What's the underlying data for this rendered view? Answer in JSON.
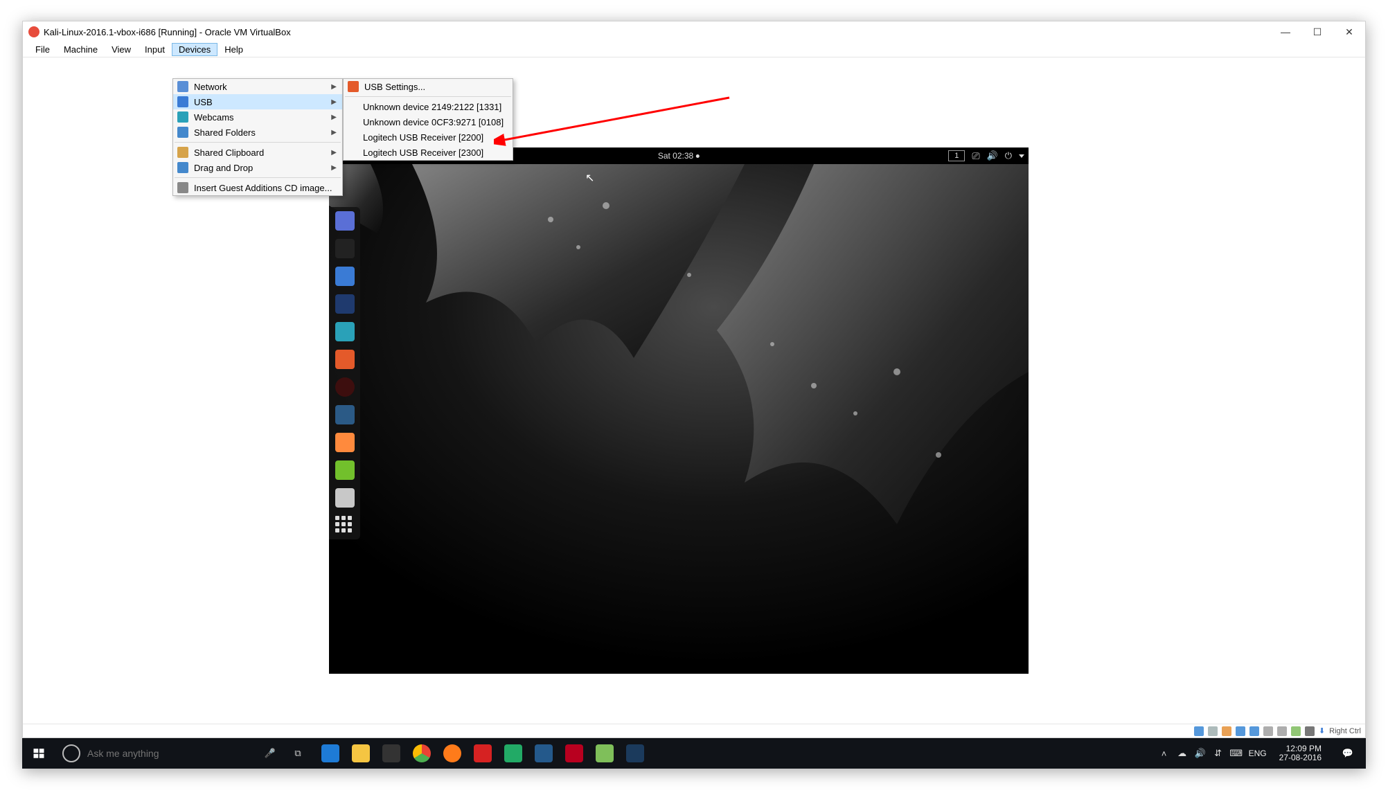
{
  "vbox": {
    "title": "Kali-Linux-2016.1-vbox-i686 [Running] - Oracle VM VirtualBox",
    "menubar": [
      "File",
      "Machine",
      "View",
      "Input",
      "Devices",
      "Help"
    ],
    "active_menu": "Devices",
    "status_label": "Right Ctrl"
  },
  "devices_menu": {
    "items": [
      {
        "icon": "net",
        "label": "Network",
        "submenu": true
      },
      {
        "icon": "usb",
        "label": "USB",
        "submenu": true,
        "highlight": true
      },
      {
        "icon": "cam",
        "label": "Webcams",
        "submenu": true
      },
      {
        "icon": "folder",
        "label": "Shared Folders",
        "submenu": true
      },
      {
        "sep": true
      },
      {
        "icon": "clip",
        "label": "Shared Clipboard",
        "submenu": true
      },
      {
        "icon": "drag",
        "label": "Drag and Drop",
        "submenu": true
      },
      {
        "sep": true
      },
      {
        "icon": "cd",
        "label": "Insert Guest Additions CD image..."
      }
    ]
  },
  "usb_menu": {
    "settings_label": "USB Settings...",
    "devices": [
      "Unknown device 2149:2122 [1331]",
      "Unknown device 0CF3:9271 [0108]",
      "Logitech USB Receiver [2200]",
      "Logitech USB Receiver [2300]"
    ]
  },
  "guest": {
    "clock": "Sat 02:38",
    "workspace": "1"
  },
  "windows_taskbar": {
    "search_placeholder": "Ask me anything",
    "lang": "ENG",
    "clock_time": "12:09 PM",
    "clock_date": "27-08-2016"
  }
}
